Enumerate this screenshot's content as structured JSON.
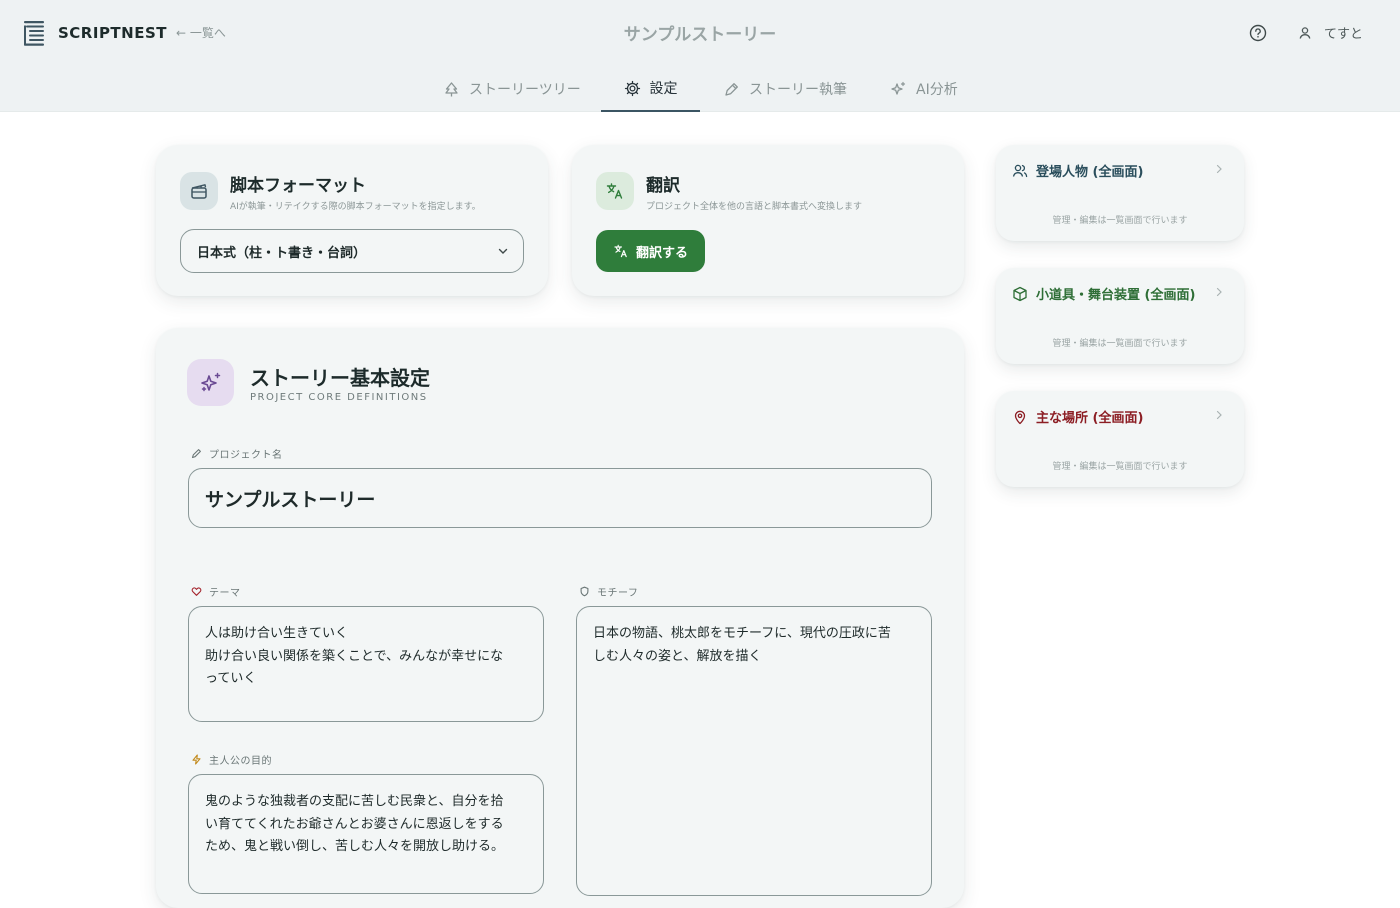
{
  "header": {
    "logo_text": "SCRIPTNEST",
    "back_link": "← 一覧へ",
    "title": "サンプルストーリー",
    "user_name": "てすと"
  },
  "tabs": [
    {
      "label": "ストーリーツリー",
      "icon": "tree-icon",
      "active": false
    },
    {
      "label": "設定",
      "icon": "gear-icon",
      "active": true
    },
    {
      "label": "ストーリー執筆",
      "icon": "pen-icon",
      "active": false
    },
    {
      "label": "AI分析",
      "icon": "sparkle-icon",
      "active": false
    }
  ],
  "format_card": {
    "title": "脚本フォーマット",
    "subtitle": "AIが執筆・リテイクする際の脚本フォーマットを指定します。",
    "selected": "日本式（柱・ト書き・台詞）"
  },
  "translate_card": {
    "title": "翻訳",
    "subtitle": "プロジェクト全体を他の言語と脚本書式へ変換します",
    "button": "翻訳する"
  },
  "core": {
    "title": "ストーリー基本設定",
    "subtitle": "PROJECT CORE DEFINITIONS",
    "project_name_label": "プロジェクト名",
    "project_name": "サンプルストーリー",
    "theme_label": "テーマ",
    "theme": "人は助け合い生きていく\n助け合い良い関係を築くことで、みんなが幸せにな\nっていく",
    "motif_label": "モチーフ",
    "motif": "日本の物語、桃太郎をモチーフに、現代の圧政に苦\nしむ人々の姿と、解放を描く",
    "goal_label": "主人公の目的",
    "goal": "鬼のような独裁者の支配に苦しむ民衆と、自分を拾\nい育ててくれたお爺さんとお婆さんに恩返しをする\nため、鬼と戦い倒し、苦しむ人々を開放し助ける。"
  },
  "side": [
    {
      "label": "登場人物 (全画面)",
      "note": "管理・編集は一覧画面で行います",
      "color": "#2a4e5c"
    },
    {
      "label": "小道具・舞台装置 (全画面)",
      "note": "管理・編集は一覧画面で行います",
      "color": "#2e6e36"
    },
    {
      "label": "主な場所 (全画面)",
      "note": "管理・編集は一覧画面で行います",
      "color": "#8c1e24"
    }
  ],
  "colors": {
    "accent_green": "#2f7d3b",
    "active_tab": "#3b5563"
  }
}
